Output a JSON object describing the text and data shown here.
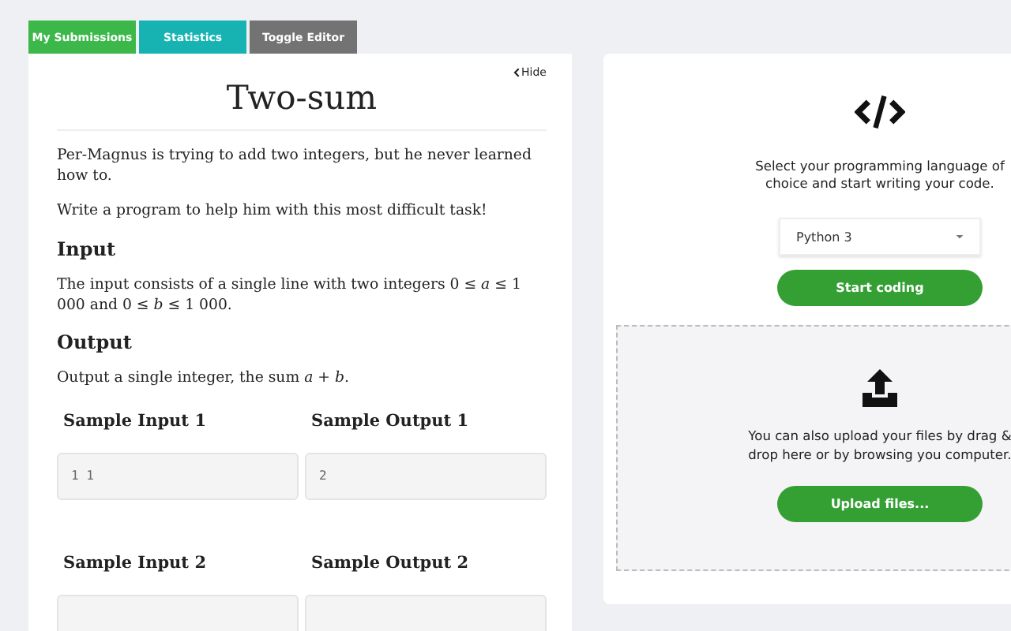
{
  "tabs": [
    {
      "label": "My Submissions",
      "kind": "green"
    },
    {
      "label": "Statistics",
      "kind": "teal"
    },
    {
      "label": "Toggle Editor",
      "kind": "grey"
    }
  ],
  "problem": {
    "hide_link": "Hide",
    "title": "Two-sum",
    "paragraphs": [
      "Per-Magnus is trying to add two integers, but he never learned how to.",
      "Write a program to help him with this most difficult task!"
    ],
    "sections": [
      {
        "heading": "Input",
        "text": "The input consists of a single line with two integers 0 ≤ *a* ≤ 1 000 and 0 ≤ *b* ≤ 1 000."
      },
      {
        "heading": "Output",
        "text": "Output a single integer, the sum *a* + *b*."
      }
    ],
    "samples": [
      {
        "input_label": "Sample Input 1",
        "input": "1 1",
        "output_label": "Sample Output 1",
        "output": "2"
      },
      {
        "input_label": "Sample Input 2",
        "output_label": "Sample Output 2"
      }
    ]
  },
  "editor": {
    "prompt": "Select your programming language of choice and start writing your code.",
    "language": "Python 3",
    "start_button": "Start coding",
    "upload_text": "You can also upload your files by drag & drop here or by browsing you computer.",
    "upload_button": "Upload files..."
  }
}
